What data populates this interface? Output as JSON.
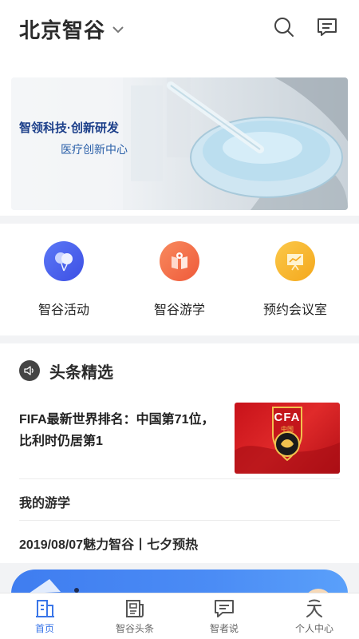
{
  "header": {
    "city": "北京智谷",
    "chevron_icon": "chevron-down-icon",
    "search_icon": "search-icon",
    "message_icon": "message-icon"
  },
  "banner": {
    "title": "智领科技·创新研发",
    "subtitle": "医疗创新中心"
  },
  "quick_actions": [
    {
      "label": "智谷活动",
      "icon": "balloon-icon",
      "color": "#4a63f0"
    },
    {
      "label": "智谷游学",
      "icon": "map-book-icon",
      "color": "#f4704a"
    },
    {
      "label": "预约会议室",
      "icon": "presentation-board-icon",
      "color": "#f7b52c"
    }
  ],
  "news": {
    "section_title": "头条精选",
    "featured": {
      "title": "FIFA最新世界排名：中国第71位，比利时仍居第1",
      "thumb_text": "CFA",
      "thumb_subtext": "中国"
    },
    "items": [
      {
        "title": "我的游学"
      },
      {
        "title": "2019/08/07魅力智谷丨七夕预热"
      }
    ]
  },
  "tabbar": {
    "active_color": "#3a76e8",
    "tabs": [
      {
        "label": "首页",
        "icon": "home-building-icon",
        "active": true
      },
      {
        "label": "智谷头条",
        "icon": "newspaper-icon",
        "active": false
      },
      {
        "label": "智者说",
        "icon": "chat-bubble-icon",
        "active": false
      },
      {
        "label": "个人中心",
        "icon": "person-icon",
        "active": false
      }
    ]
  }
}
